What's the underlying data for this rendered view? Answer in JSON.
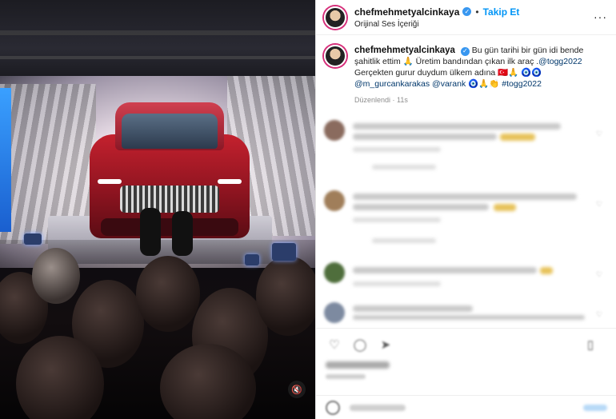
{
  "post": {
    "username": "chefmehmetyalcinkaya",
    "follow_label": "Takip Et",
    "separator": "•",
    "audio_label": "Orijinal Ses İçeriği",
    "more_label": "···",
    "caption_pre": " Bu gün tarihi bir gün idi bende şahitlik ettim 🙏 Üretim bandından çıkan ilk araç .",
    "caption_tag1": "@togg2022",
    "caption_mid": " Gerçekten gurur duydum ülkem adına 🇹🇷🙏 🧿🧿",
    "caption_tag2": "@m_gurcankarakas",
    "caption_tag3": "@varank",
    "caption_emojis": " 🧿🙏👏 ",
    "caption_tag4": "#togg2022",
    "meta": "Düzenlendi · 11s",
    "mute_icon": "🔇"
  },
  "colors": {
    "accent": "#0095f6",
    "verified": "#3897f0",
    "ring": "#d62f7a"
  }
}
